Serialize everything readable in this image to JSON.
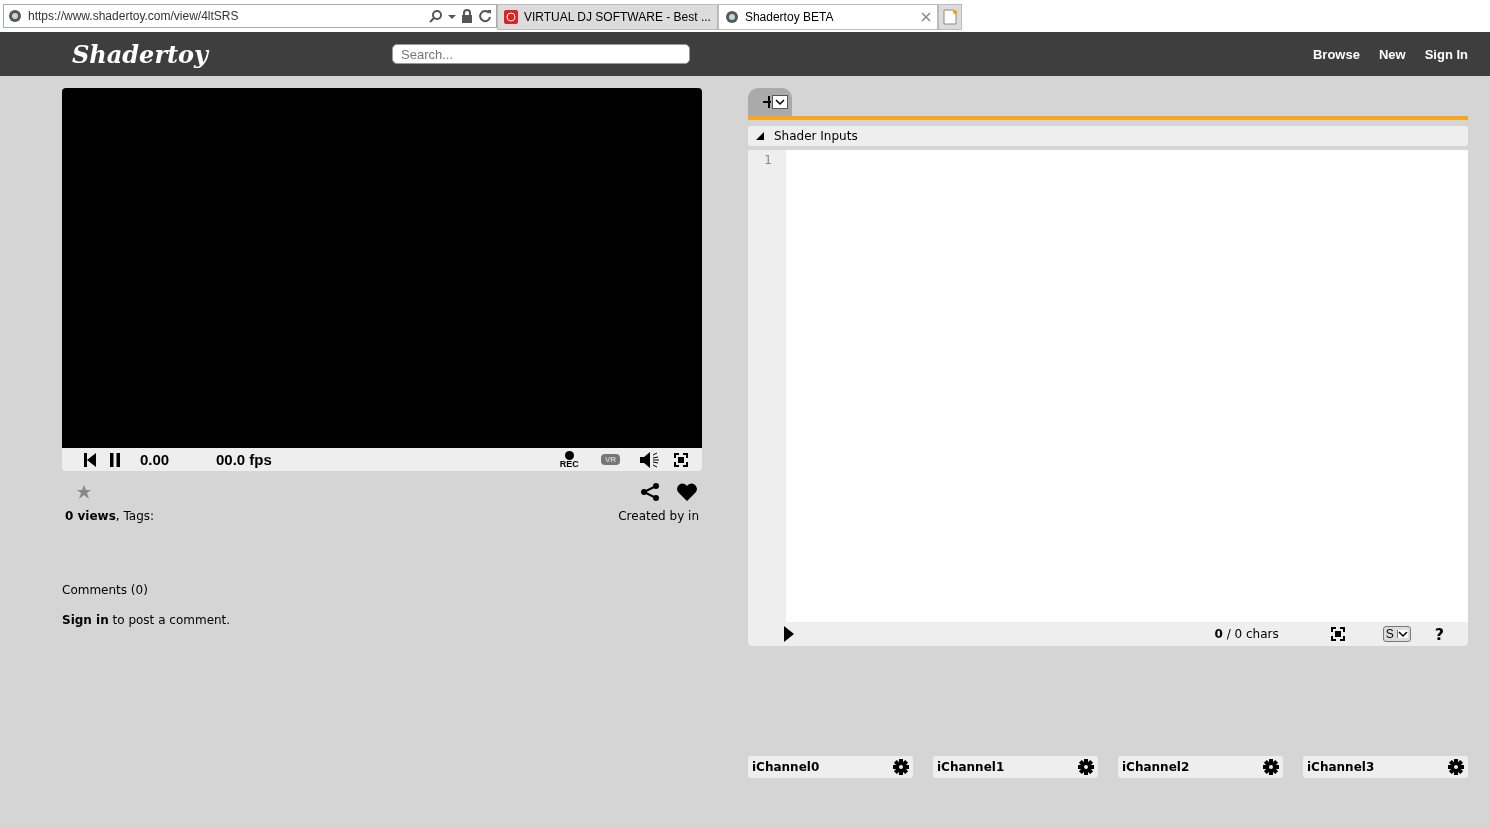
{
  "browser": {
    "address": "https://www.shadertoy.com/view/4ltSRS",
    "tabs": [
      {
        "title": "VIRTUAL DJ SOFTWARE - Best ...",
        "selected": false
      },
      {
        "title": "Shadertoy BETA",
        "selected": true
      }
    ]
  },
  "header": {
    "logo": "Shadertoy",
    "search": {
      "placeholder": "Search..."
    },
    "nav": [
      "Browse",
      "New",
      "Sign In"
    ]
  },
  "player": {
    "time": "0.00",
    "fps": "00.0 fps",
    "rec_label": "REC",
    "vr_label": "VR"
  },
  "info": {
    "views": "**0 views**, Tags:",
    "created": "Created by in"
  },
  "comments": {
    "title": "Comments (0)",
    "sign_in_link": "Sign in",
    "prompt": " to post a comment."
  },
  "editor": {
    "shader_inputs": {
      "label": "Shader Inputs",
      "expanded": false
    },
    "line_numbers": [
      "1"
    ],
    "char_count": "**0** / 0 chars",
    "font_select": "S",
    "help": "?"
  },
  "channels": [
    "iChannel0",
    "iChannel1",
    "iChannel2",
    "iChannel3"
  ]
}
